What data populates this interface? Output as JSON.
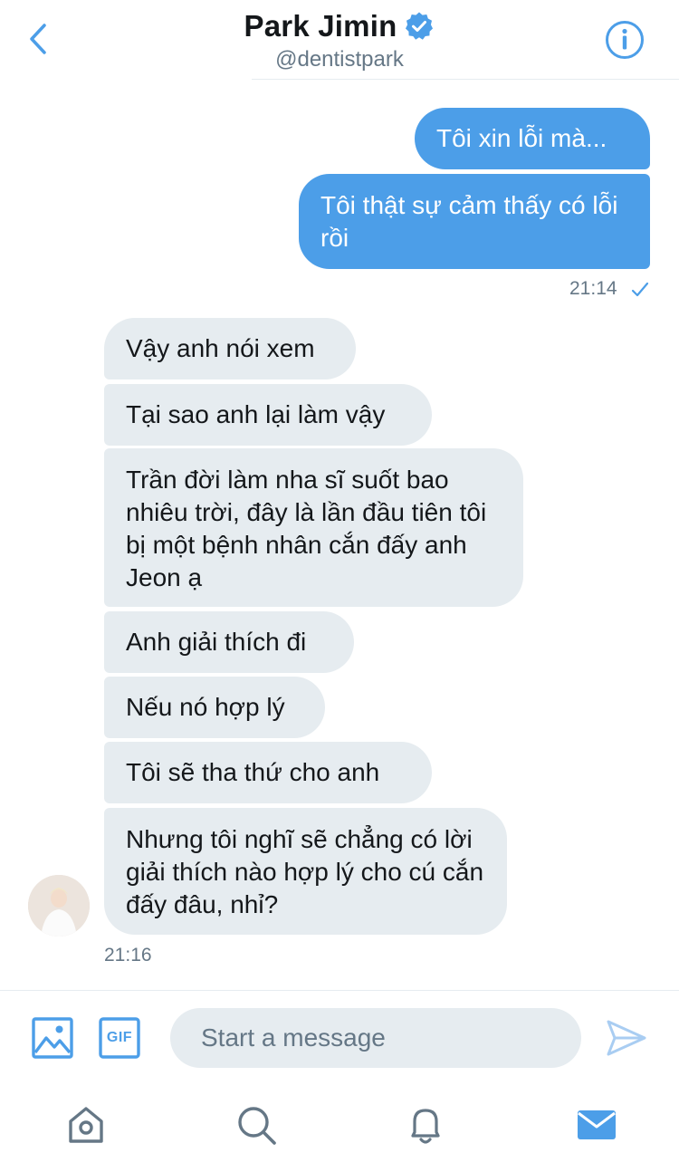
{
  "header": {
    "name": "Park Jimin",
    "handle": "@dentistpark",
    "back_icon": "chevron-left-icon",
    "info_icon": "info-icon",
    "verified_icon": "verified-badge-icon"
  },
  "outgoing": {
    "messages": [
      "Tôi xin lỗi mà...",
      "Tôi thật sự cảm thấy có lỗi rồi"
    ],
    "time": "21:14",
    "status_icon": "sent-check-icon"
  },
  "incoming": {
    "messages": [
      "Vậy anh nói xem",
      "Tại sao anh lại làm vậy",
      "Trần đời làm nha sĩ suốt bao nhiêu trời, đây là lần đầu tiên tôi bị một bệnh nhân cắn đấy anh Jeon ạ",
      "Anh giải thích đi",
      "Nếu nó hợp lý",
      "Tôi sẽ tha thứ cho anh",
      "Nhưng tôi nghĩ sẽ chẳng có lời giải thích nào hợp lý cho cú cắn đấy đâu, nhỉ?"
    ],
    "time": "21:16"
  },
  "composer": {
    "placeholder": "Start a message",
    "media_icon": "image-icon",
    "gif_label": "GIF",
    "send_icon": "send-icon"
  },
  "tabbar": {
    "items": [
      "home-icon",
      "search-icon",
      "notifications-bell-icon",
      "messages-mail-icon"
    ],
    "active": "messages-mail-icon"
  },
  "colors": {
    "accent": "#4c9ee8",
    "incoming_bubble": "#e6ecf0",
    "text": "#14171a",
    "secondary_text": "#657786"
  }
}
